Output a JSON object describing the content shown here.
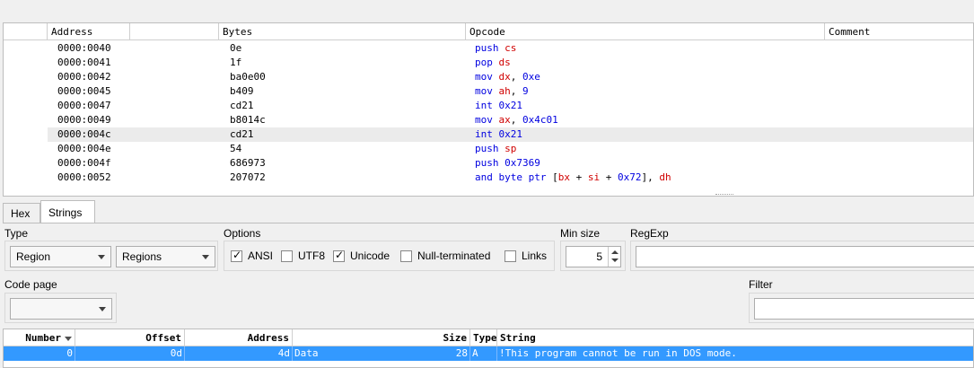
{
  "disasm": {
    "columns": [
      "Address",
      "Bytes",
      "Opcode",
      "Comment"
    ],
    "rows": [
      {
        "address": "0000:0040",
        "bytes": "0e",
        "op": [
          [
            "mn",
            "push"
          ],
          [
            "sp",
            " "
          ],
          [
            "reg",
            "cs"
          ]
        ]
      },
      {
        "address": "0000:0041",
        "bytes": "1f",
        "op": [
          [
            "mn",
            "pop"
          ],
          [
            "sp",
            " "
          ],
          [
            "reg",
            "ds"
          ]
        ]
      },
      {
        "address": "0000:0042",
        "bytes": "ba0e00",
        "op": [
          [
            "mn",
            "mov"
          ],
          [
            "sp",
            " "
          ],
          [
            "reg",
            "dx"
          ],
          [
            "sym",
            ", "
          ],
          [
            "imm",
            "0xe"
          ]
        ]
      },
      {
        "address": "0000:0045",
        "bytes": "b409",
        "op": [
          [
            "mn",
            "mov"
          ],
          [
            "sp",
            " "
          ],
          [
            "reg",
            "ah"
          ],
          [
            "sym",
            ", "
          ],
          [
            "imm",
            "9"
          ]
        ]
      },
      {
        "address": "0000:0047",
        "bytes": "cd21",
        "op": [
          [
            "mn",
            "int"
          ],
          [
            "sp",
            " "
          ],
          [
            "imm",
            "0x21"
          ]
        ]
      },
      {
        "address": "0000:0049",
        "bytes": "b8014c",
        "op": [
          [
            "mn",
            "mov"
          ],
          [
            "sp",
            " "
          ],
          [
            "reg",
            "ax"
          ],
          [
            "sym",
            ", "
          ],
          [
            "imm",
            "0x4c01"
          ]
        ]
      },
      {
        "address": "0000:004c",
        "bytes": "cd21",
        "op": [
          [
            "mn",
            "int"
          ],
          [
            "sp",
            " "
          ],
          [
            "imm",
            "0x21"
          ]
        ],
        "selected": true
      },
      {
        "address": "0000:004e",
        "bytes": "54",
        "op": [
          [
            "mn",
            "push"
          ],
          [
            "sp",
            " "
          ],
          [
            "reg",
            "sp"
          ]
        ]
      },
      {
        "address": "0000:004f",
        "bytes": "686973",
        "op": [
          [
            "mn",
            "push"
          ],
          [
            "sp",
            " "
          ],
          [
            "imm",
            "0x7369"
          ]
        ]
      },
      {
        "address": "0000:0052",
        "bytes": "207072",
        "op": [
          [
            "mn",
            "and byte ptr"
          ],
          [
            "sym",
            " ["
          ],
          [
            "reg",
            "bx"
          ],
          [
            "sym",
            " + "
          ],
          [
            "reg",
            "si"
          ],
          [
            "sym",
            " + "
          ],
          [
            "imm",
            "0x72"
          ],
          [
            "sym",
            "], "
          ],
          [
            "reg",
            "dh"
          ]
        ]
      }
    ]
  },
  "tabs": {
    "hex": "Hex",
    "strings": "Strings"
  },
  "panel": {
    "type_label": "Type",
    "type_value": "Region",
    "regions_value": "Regions",
    "options_label": "Options",
    "options": {
      "ansi": {
        "label": "ANSI",
        "checked": true
      },
      "utf8": {
        "label": "UTF8",
        "checked": false
      },
      "unicode": {
        "label": "Unicode",
        "checked": true
      },
      "null_terminated": {
        "label": "Null-terminated",
        "checked": false
      },
      "links": {
        "label": "Links",
        "checked": false
      }
    },
    "min_size_label": "Min size",
    "min_size_value": "5",
    "regexp_label": "RegExp",
    "regexp_value": "",
    "code_page_label": "Code page",
    "code_page_value": "",
    "filter_label": "Filter",
    "filter_value": ""
  },
  "results": {
    "columns": {
      "number": "Number",
      "offset": "Offset",
      "address": "Address",
      "blank": "",
      "size": "Size",
      "type": "Type",
      "string": "String"
    },
    "rows": [
      {
        "number": "0",
        "offset": "0d",
        "address": "4d",
        "region": "Data",
        "size": "28",
        "type": "A",
        "string": "!This program cannot be run in DOS mode."
      }
    ]
  },
  "colors": {
    "mnemonic": "#0000e0",
    "register": "#d00000",
    "selection": "#3399ff",
    "row_highlight": "#ebebeb"
  }
}
